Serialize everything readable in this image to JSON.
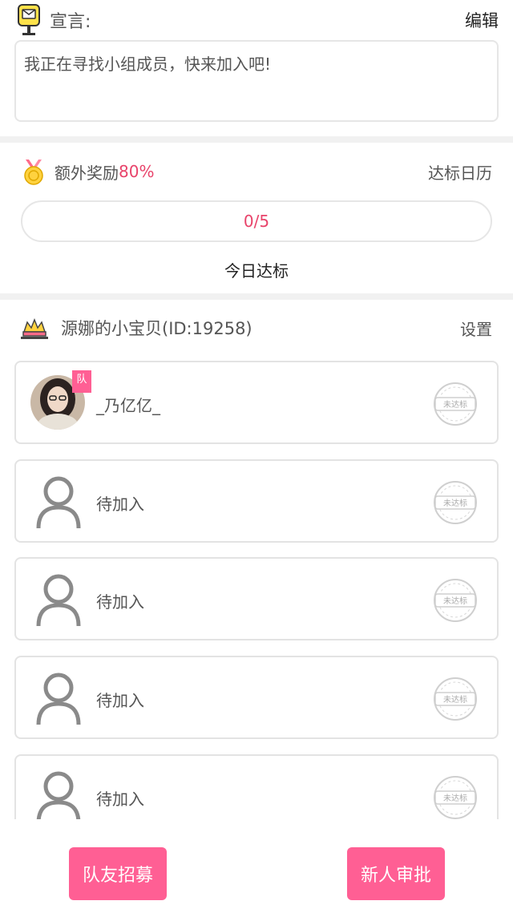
{
  "declaration": {
    "title": "宣言:",
    "edit_label": "编辑",
    "text": "我正在寻找小组成员，快来加入吧!"
  },
  "reward": {
    "label": "额外奖励",
    "percent": "80%",
    "calendar_label": "达标日历",
    "progress_text": "0/5",
    "progress_fraction": 0,
    "today_label": "今日达标"
  },
  "team": {
    "name": "源娜的小宝贝(ID:19258)",
    "settings_label": "设置",
    "members": [
      {
        "name": "_乃亿亿_",
        "badge": "队",
        "stamp": "未达标",
        "is_placeholder": false
      },
      {
        "name": "待加入",
        "stamp": "未达标",
        "is_placeholder": true
      },
      {
        "name": "待加入",
        "stamp": "未达标",
        "is_placeholder": true
      },
      {
        "name": "待加入",
        "stamp": "未达标",
        "is_placeholder": true
      },
      {
        "name": "待加入",
        "stamp": "未达标",
        "is_placeholder": true
      }
    ]
  },
  "actions": {
    "recruit_label": "队友招募",
    "approve_label": "新人审批"
  },
  "colors": {
    "accent": "#ff5f94",
    "highlight_text": "#e8436a"
  }
}
